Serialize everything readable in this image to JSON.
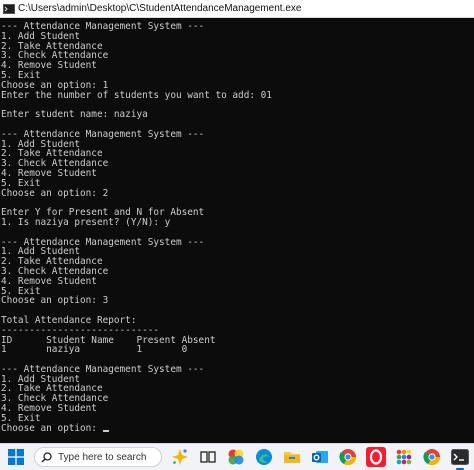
{
  "window": {
    "title": "C:\\Users\\admin\\Desktop\\C\\StudentAttendanceManagement.exe"
  },
  "console": {
    "lines": [
      "--- Attendance Management System ---",
      "1. Add Student",
      "2. Take Attendance",
      "3. Check Attendance",
      "4. Remove Student",
      "5. Exit",
      "Choose an option: 1",
      "Enter the number of students you want to add: 01",
      "",
      "Enter student name: naziya",
      "",
      "--- Attendance Management System ---",
      "1. Add Student",
      "2. Take Attendance",
      "3. Check Attendance",
      "4. Remove Student",
      "5. Exit",
      "Choose an option: 2",
      "",
      "Enter Y for Present and N for Absent",
      "1. Is naziya present? (Y/N): y",
      "",
      "--- Attendance Management System ---",
      "1. Add Student",
      "2. Take Attendance",
      "3. Check Attendance",
      "4. Remove Student",
      "5. Exit",
      "Choose an option: 3",
      "",
      "Total Attendance Report:",
      "----------------------------",
      "ID      Student Name    Present Absent",
      "1       naziya          1       0",
      "",
      "--- Attendance Management System ---",
      "1. Add Student",
      "2. Take Attendance",
      "3. Check Attendance",
      "4. Remove Student",
      "5. Exit"
    ],
    "prompt": "Choose an option: "
  },
  "taskbar": {
    "search_placeholder": "Type here to search",
    "icons": [
      "windows-start-icon",
      "search-icon",
      "copilot-sparkle-icon",
      "task-view-icon",
      "colorful-app-icon",
      "edge-icon",
      "file-explorer-icon",
      "outlook-icon",
      "chrome-icon",
      "opera-icon",
      "app-grid-icon",
      "chrome-icon",
      "terminal-icon"
    ],
    "accent_color": "#0067c0"
  }
}
